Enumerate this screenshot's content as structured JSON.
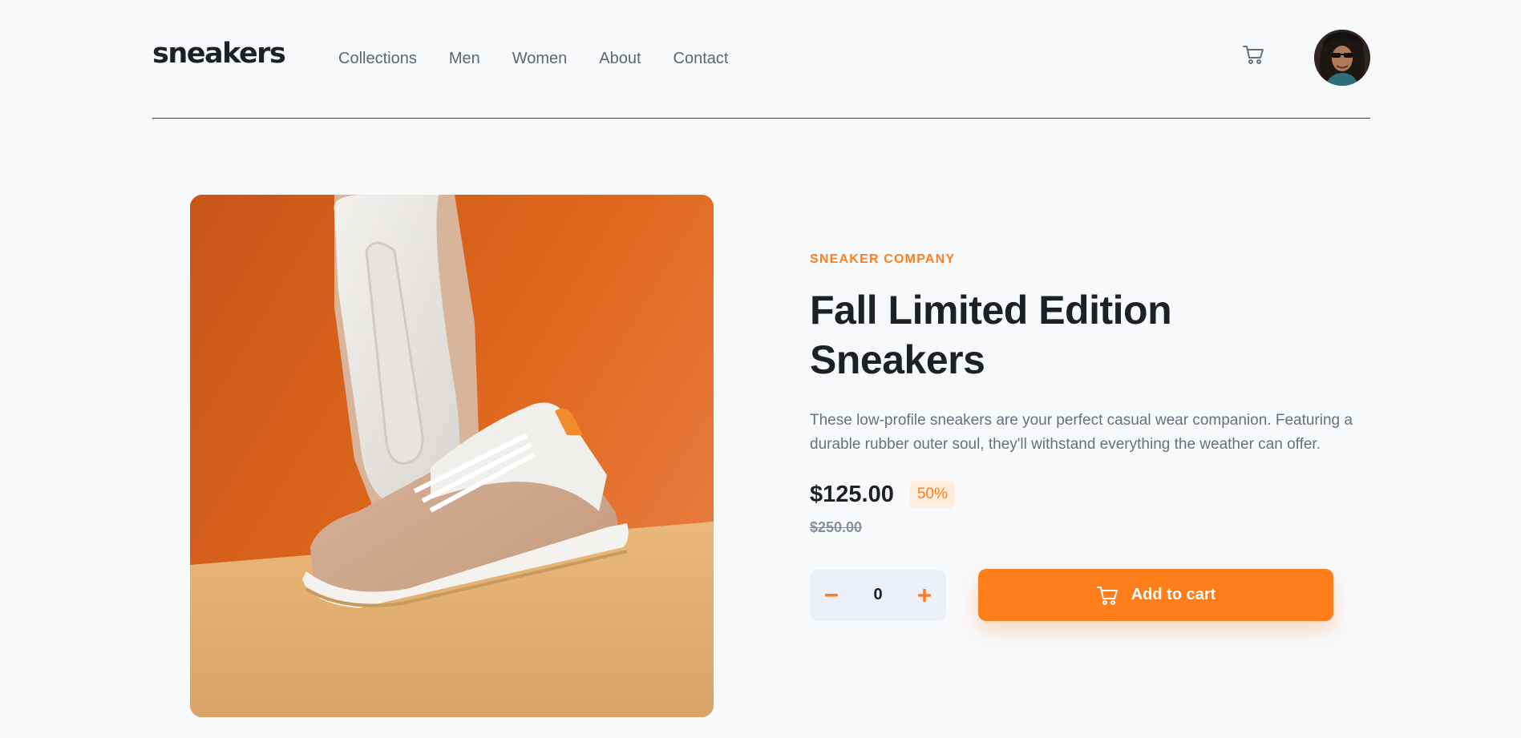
{
  "colors": {
    "accent": "#ff7d1a",
    "accent_pale": "#ffede0",
    "text_dark": "#1d2026",
    "text_gray": "#68707d"
  },
  "header": {
    "logo": "sneakers",
    "nav": [
      "Collections",
      "Men",
      "Women",
      "About",
      "Contact"
    ],
    "cart_icon": "cart-icon",
    "avatar_icon": "user-avatar"
  },
  "product": {
    "company": "SNEAKER COMPANY",
    "title": "Fall Limited Edition Sneakers",
    "description": "These low-profile sneakers are your perfect casual wear companion. Featuring a durable rubber outer soul, they'll withstand everything the weather can offer.",
    "price": "$125.00",
    "discount": "50%",
    "old_price": "$250.00",
    "image_icon": "sneaker-product-image"
  },
  "cart_controls": {
    "quantity": "0",
    "minus_icon": "minus-icon",
    "plus_icon": "plus-icon",
    "add_label": "Add to cart"
  }
}
